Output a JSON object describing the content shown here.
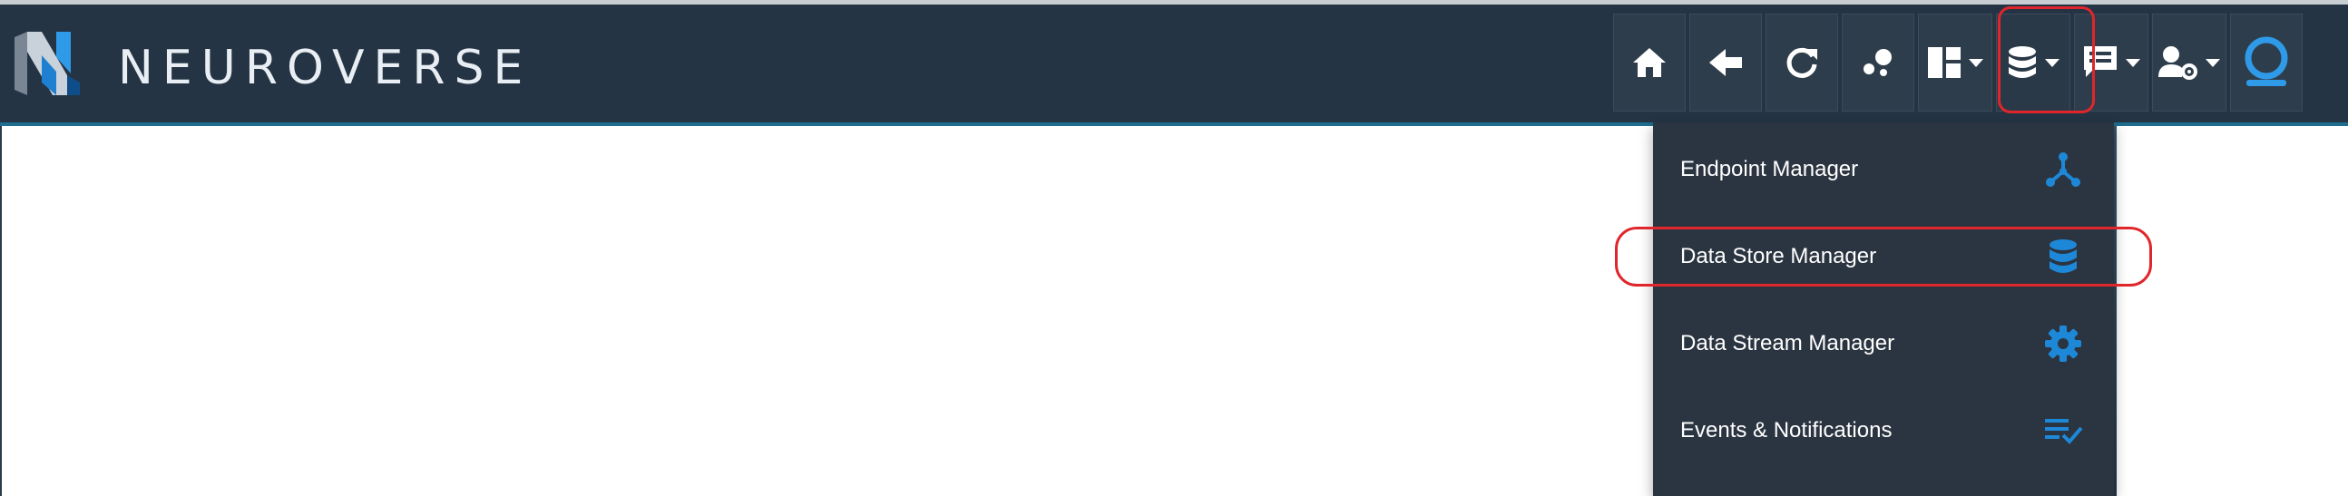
{
  "app": {
    "brand": "NEUROVERSE"
  },
  "toolbar": {
    "buttons": [
      {
        "icon": "home-icon",
        "has_caret": false
      },
      {
        "icon": "back-arrow-icon",
        "has_caret": false
      },
      {
        "icon": "refresh-icon",
        "has_caret": false
      },
      {
        "icon": "bubbles-icon",
        "has_caret": false
      },
      {
        "icon": "dashboard-icon",
        "has_caret": true
      },
      {
        "icon": "database-icon",
        "has_caret": true,
        "active": true
      },
      {
        "icon": "message-icon",
        "has_caret": true
      },
      {
        "icon": "user-settings-icon",
        "has_caret": true
      },
      {
        "icon": "profile-avatar-icon",
        "has_caret": false
      }
    ]
  },
  "dropdown": {
    "items": [
      {
        "label": "Endpoint Manager",
        "icon": "endpoint-hub-icon"
      },
      {
        "label": "Data Store Manager",
        "icon": "database-icon"
      },
      {
        "label": "Data Stream Manager",
        "icon": "gear-icon"
      },
      {
        "label": "Events & Notifications",
        "icon": "checklist-icon"
      }
    ]
  },
  "colors": {
    "header_bg": "#243444",
    "dropdown_bg": "#2b3541",
    "accent_blue": "#1e88d8",
    "highlight_red": "#e0262b"
  }
}
